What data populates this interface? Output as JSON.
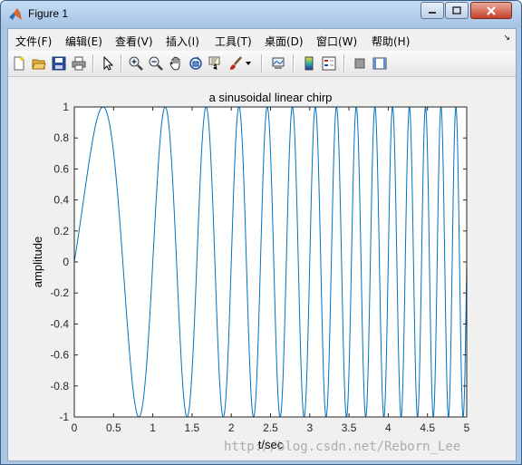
{
  "window": {
    "title": "Figure 1",
    "minimize_icon": "minimize-icon",
    "maximize_icon": "maximize-icon",
    "close_icon": "close-icon",
    "app_icon": "matlab-logo-icon"
  },
  "menu": {
    "items": [
      "文件(F)",
      "编辑(E)",
      "查看(V)",
      "插入(I)",
      "工具(T)",
      "桌面(D)",
      "窗口(W)",
      "帮助(H)"
    ],
    "overflow_arrow": "↘"
  },
  "toolbar": {
    "buttons": [
      "new-figure-icon",
      "open-file-icon",
      "save-icon",
      "print-icon",
      "edit-plot-arrow-icon",
      "zoom-in-icon",
      "zoom-out-icon",
      "pan-hand-icon",
      "rotate-3d-icon",
      "data-cursor-icon",
      "brush-icon",
      "brush-dropdown-icon",
      "link-plot-icon",
      "insert-colorbar-icon",
      "insert-legend-icon",
      "hide-plot-tools-icon",
      "show-plot-tools-icon"
    ]
  },
  "chart_data": {
    "type": "line",
    "title": "a sinusoidal linear chirp",
    "xlabel": "t/sec",
    "ylabel": "amplitude",
    "xlim": [
      0,
      5
    ],
    "ylim": [
      -1,
      1
    ],
    "xticks": [
      "0",
      "0.5",
      "1",
      "1.5",
      "2",
      "2.5",
      "3",
      "3.5",
      "4",
      "4.5",
      "5"
    ],
    "yticks": [
      "1",
      "0.8",
      "0.6",
      "0.4",
      "0.2",
      "0",
      "-0.2",
      "-0.4",
      "-0.6",
      "-0.8",
      "-1"
    ],
    "grid": false,
    "series": [
      {
        "function": "sin(2*pi*(0.5*t + 0.5*t^2))",
        "t_start": 0,
        "t_end": 5,
        "color": "#0072bd"
      }
    ]
  },
  "watermark": "http://blog.csdn.net/Reborn_Lee"
}
